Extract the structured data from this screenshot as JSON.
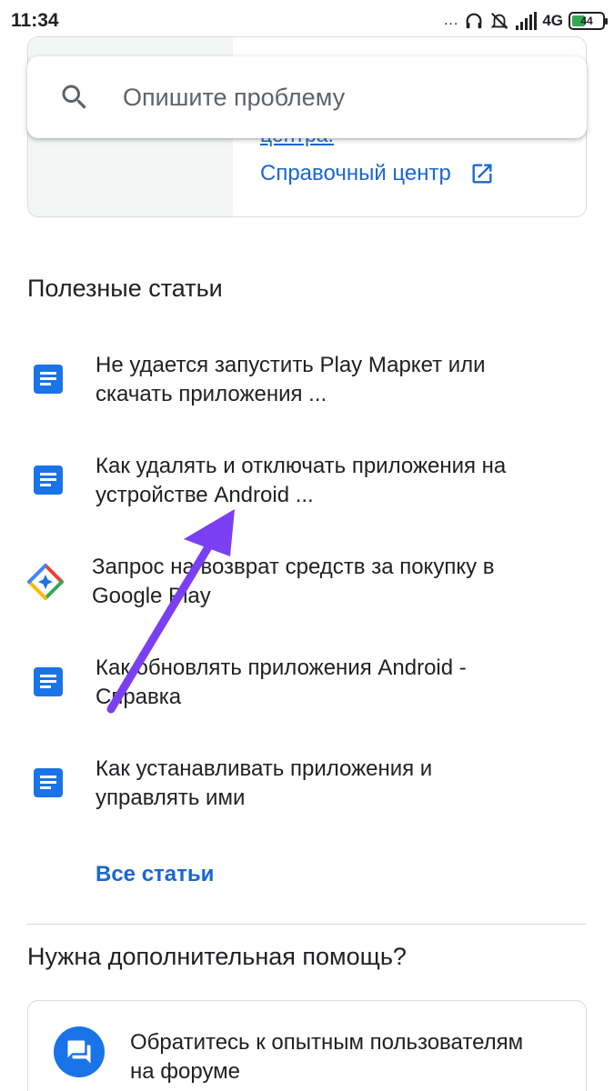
{
  "status_bar": {
    "time": "11:34",
    "dots": "...",
    "network": "4G",
    "battery": "44"
  },
  "top_card": {
    "cut_link_text": "центра.",
    "help_center_link": "Справочный центр"
  },
  "search": {
    "placeholder": "Опишите проблему"
  },
  "articles": {
    "title": "Полезные статьи",
    "items": [
      {
        "line1": "Не удается запустить Play Маркет или",
        "line2": "скачать приложения ..."
      },
      {
        "line1": "Как удалять и отключать приложения на",
        "line2": "устройстве Android ..."
      },
      {
        "line1": "Запрос на возврат средств за покупку в",
        "line2": "Google Play"
      },
      {
        "line1": "Как обновлять приложения Android -",
        "line2": "Справка"
      },
      {
        "line1": "Как устанавливать приложения и",
        "line2": "управлять ими"
      }
    ],
    "all_link": "Все статьи"
  },
  "help": {
    "title": "Нужна дополнительная помощь?",
    "forum_line1": "Обратитесь к опытным пользователям",
    "forum_line2": "на форуме"
  },
  "colors": {
    "link": "#1967d2",
    "doc_icon": "#1a73e8",
    "annotation_arrow": "#7b3ff2"
  },
  "icons": {
    "search": "search-icon",
    "external": "open-in-new-icon",
    "document": "document-icon",
    "google_play": "google-play-logo-icon",
    "forum": "forum-chat-icon"
  }
}
